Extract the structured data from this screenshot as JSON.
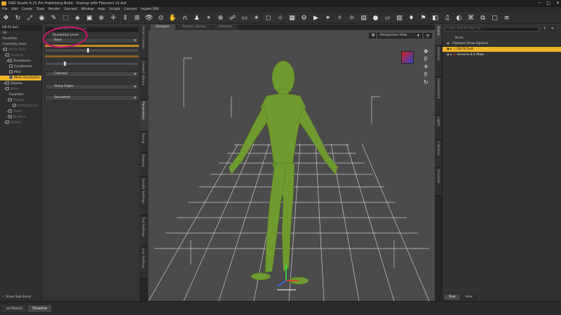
{
  "window": {
    "title": "DAZ Studio 4.21 Pro Publishing Build - Startup with Filament v2.duf",
    "min": "─",
    "max": "□",
    "close": "✕"
  },
  "menu": [
    "File",
    "Edit",
    "Create",
    "Tools",
    "Render",
    "Connect",
    "Window",
    "Help",
    "Scripts",
    "Convert",
    "Import FBX"
  ],
  "left_panel": {
    "header": "G8 Fit Suit",
    "rows": [
      {
        "label": "All",
        "state": "normal"
      },
      {
        "label": "Favorites",
        "state": "normal"
      },
      {
        "label": "Currently Used",
        "state": "normal"
      },
      {
        "label": "G8 Fit Suit",
        "state": "dim"
      },
      {
        "label": "General",
        "state": "dim"
      },
      {
        "label": "Transforms",
        "state": "normal"
      },
      {
        "label": "Constraints",
        "state": "normal"
      },
      {
        "label": "Misc",
        "state": "normal"
      },
      {
        "label": "Mesh Resolution",
        "state": "selected"
      },
      {
        "label": "Display",
        "state": "normal"
      },
      {
        "label": "Actor",
        "state": "dim"
      },
      {
        "label": "Favorites",
        "state": "normal"
      },
      {
        "label": "People",
        "state": "dim"
      },
      {
        "label": "Fantasy SciFi",
        "state": "dim"
      },
      {
        "label": "Pose",
        "state": "dim"
      },
      {
        "label": "Surface",
        "state": "dim"
      },
      {
        "label": "Hidden",
        "state": "dim"
      }
    ],
    "footer": "Show Sub Items"
  },
  "params": {
    "filter_placeholder": "Enter text to filter by...",
    "resolution_label": "Resolution Level",
    "resolution_value": "Base",
    "catmark_value": "Catmark",
    "edges_value": "Sharp Edges",
    "smooth_value": "Smoothed",
    "slider_a": 0.45,
    "slider_b": 0.2
  },
  "vtabs_left": [
    "Smart Content",
    "Content Library",
    "Parameters",
    "Posing",
    "Shaping",
    "Render Settings",
    "Tool Settings",
    "Aux Settings"
  ],
  "viewport": {
    "tabs": [
      "Viewport",
      "Render Library",
      "Validator"
    ],
    "camera": "Perspective View"
  },
  "vtabs_right": [
    "Scene",
    "Surfaces",
    "Environment",
    "Lights",
    "Cameras",
    "Universe"
  ],
  "scene": {
    "search_placeholder": "Enter text to filter by...",
    "header": "Node",
    "nodes": [
      {
        "label": "Filament Draw Options",
        "state": "normal"
      },
      {
        "label": "G8 Fit Suit",
        "state": "selected"
      },
      {
        "label": "Genesis 8.1 Male",
        "state": "normal"
      }
    ],
    "footer_tabs": [
      "Tree",
      "Hide"
    ]
  },
  "bottom_tabs": [
    "aniMate2",
    "Timeline"
  ],
  "colors": {
    "accent": "#f0b429",
    "figure": "#6f9a30",
    "annotation": "#c8166b"
  }
}
